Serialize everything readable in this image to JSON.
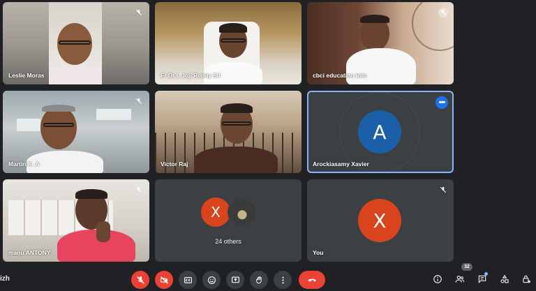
{
  "participants": [
    {
      "name": "Leslie Moras",
      "muted": true
    },
    {
      "name": "Fr Dr L Joji Reddy SJ",
      "muted": false
    },
    {
      "name": "cbci education info",
      "muted": true
    },
    {
      "name": "Martin K. A",
      "muted": true
    },
    {
      "name": "Victor Raj",
      "muted": false
    },
    {
      "name": "Arockiasamy Xavier",
      "avatar_letter": "A",
      "avatar_color": "#1a5fa8",
      "muted": false,
      "active": true,
      "more_label": "•••"
    },
    {
      "name": "manu ANTONY",
      "muted": true
    },
    {
      "others_label": "24 others",
      "avatar_letter": "X",
      "avatar_color": "#d9441c"
    },
    {
      "name": "You",
      "avatar_letter": "X",
      "avatar_color": "#d9441c",
      "muted": true
    }
  ],
  "toolbar": {
    "meeting_name": "izh",
    "participant_count": "32"
  },
  "colors": {
    "background": "#202124",
    "tile": "#3c4043",
    "danger": "#ea4335",
    "accent": "#8ab4f8"
  },
  "icons": [
    "mic-off-icon",
    "camera-off-icon",
    "captions-icon",
    "emoji-icon",
    "present-icon",
    "raise-hand-icon",
    "more-options-icon",
    "end-call-icon",
    "info-icon",
    "people-icon",
    "chat-icon",
    "activities-icon",
    "host-controls-icon"
  ]
}
